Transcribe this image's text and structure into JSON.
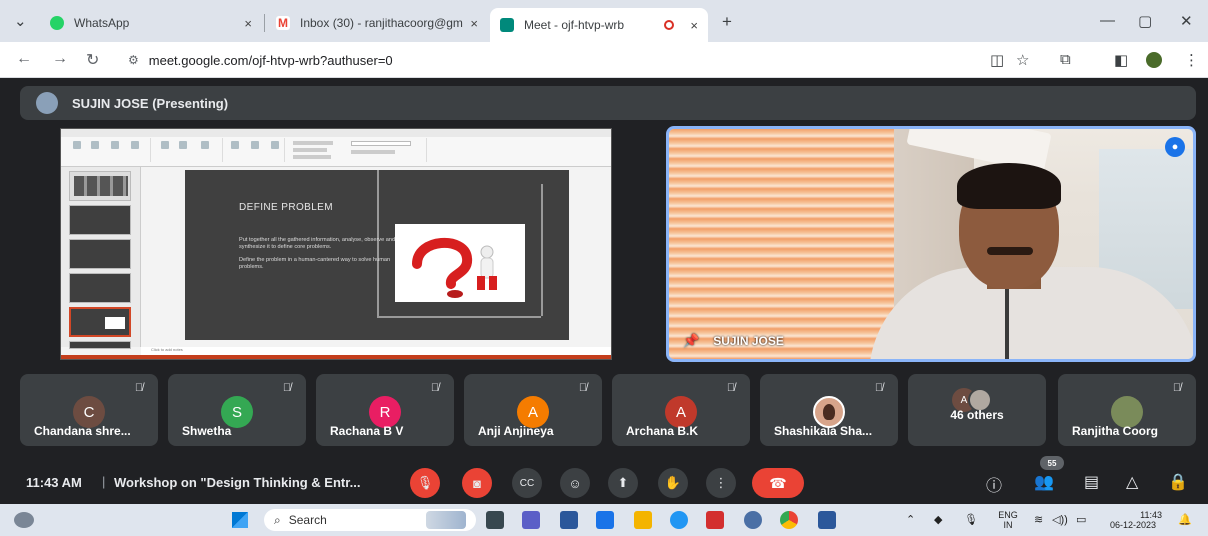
{
  "browser": {
    "tabs": [
      {
        "label": "WhatsApp",
        "close": "×"
      },
      {
        "label": "Inbox (30) - ranjithacoorg@gm",
        "close": "×"
      },
      {
        "label": "Meet - ojf-htvp-wrb",
        "close": "×",
        "active": true
      }
    ],
    "new_tab": "+",
    "url": "meet.google.com/ojf-htvp-wrb?authuser=0",
    "colors": {
      "whatsapp": "#25d366",
      "gmail": "#ea4335",
      "meet": "#00897b",
      "recording": "#d93025"
    }
  },
  "meet": {
    "presenting_bar": "SUJIN JOSE (Presenting)",
    "slide": {
      "title": "DEFINE PROBLEM",
      "paragraphs": [
        "Put together all the gathered information, analyse, observe and synthesize it to define core problems.",
        "Define the problem in a human-cantered way to solve human problems."
      ],
      "notes_placeholder": "Click to add notes"
    },
    "speaker": {
      "name": "SUJIN JOSE"
    },
    "participants": [
      {
        "initial": "C",
        "name": "Chandana shre...",
        "color": "#6d4c41"
      },
      {
        "initial": "S",
        "name": "Shwetha",
        "color": "#34a853"
      },
      {
        "initial": "R",
        "name": "Rachana B V",
        "color": "#e91e63"
      },
      {
        "initial": "A",
        "name": "Anji Anjineya",
        "color": "#f57c00"
      },
      {
        "initial": "A",
        "name": "Archana B.K",
        "color": "#c0392b"
      },
      {
        "initial": "",
        "name": "Shashikala Sha...",
        "color": "#d7a48a"
      },
      {
        "initial": "A",
        "name": "46 others",
        "color": "#6d4c41"
      },
      {
        "initial": "",
        "name": "Ranjitha Coorg",
        "color": "#7a8b5a"
      }
    ],
    "controls": {
      "time": "11:43 AM",
      "separator": "|",
      "meeting_title": "Workshop on \"Design Thinking & Entr...",
      "participant_count": "55"
    }
  },
  "taskbar": {
    "search_placeholder": "Search",
    "lang_top": "ENG",
    "lang_bottom": "IN",
    "time": "11:43",
    "date": "06-12-2023"
  }
}
